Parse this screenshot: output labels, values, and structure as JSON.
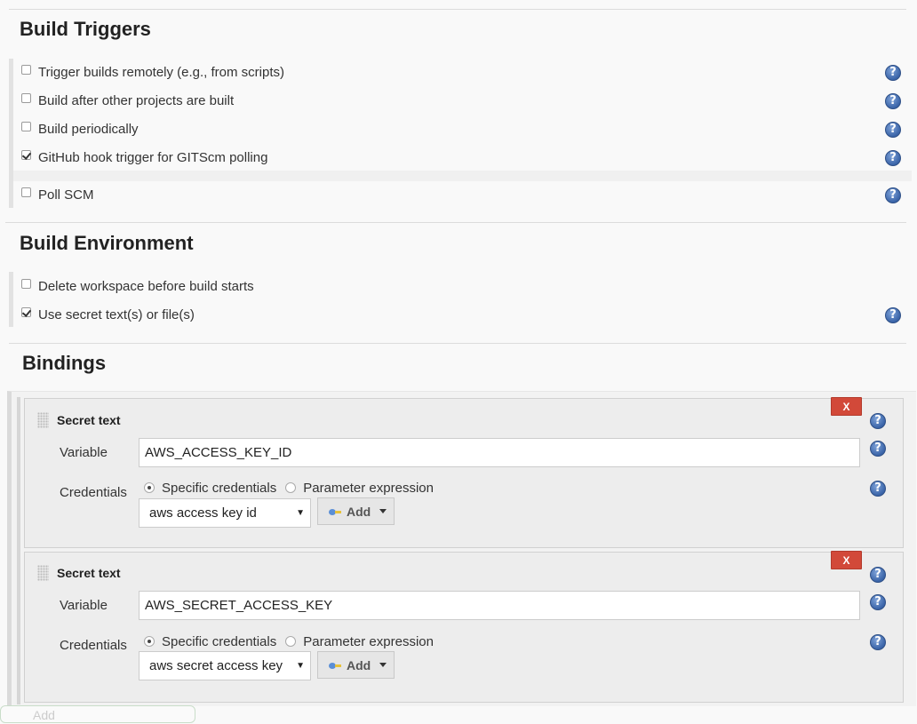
{
  "build_triggers": {
    "title": "Build Triggers",
    "options": [
      {
        "label": "Trigger builds remotely (e.g., from scripts)",
        "checked": false
      },
      {
        "label": "Build after other projects are built",
        "checked": false
      },
      {
        "label": "Build periodically",
        "checked": false
      },
      {
        "label": "GitHub hook trigger for GITScm polling",
        "checked": true
      },
      {
        "label": "Poll SCM",
        "checked": false
      }
    ]
  },
  "build_environment": {
    "title": "Build Environment",
    "options": [
      {
        "label": "Delete workspace before build starts",
        "checked": false
      },
      {
        "label": "Use secret text(s) or file(s)",
        "checked": true
      }
    ]
  },
  "bindings": {
    "title": "Bindings",
    "delete_label": "X",
    "help_glyph": "?",
    "items": [
      {
        "type_title": "Secret text",
        "variable_label": "Variable",
        "variable_value": "AWS_ACCESS_KEY_ID",
        "credentials_label": "Credentials",
        "radio_specific": "Specific credentials",
        "radio_param": "Parameter expression",
        "selected_credential": "aws access key id",
        "add_label": "Add"
      },
      {
        "type_title": "Secret text",
        "variable_label": "Variable",
        "variable_value": "AWS_SECRET_ACCESS_KEY",
        "credentials_label": "Credentials",
        "radio_specific": "Specific credentials",
        "radio_param": "Parameter expression",
        "selected_credential": "aws secret access key",
        "add_label": "Add"
      }
    ],
    "add_binding_label": "Add"
  },
  "colors": {
    "delete_button": "#d24939",
    "help_icon": "#3a64a8",
    "section_title": "#222222"
  },
  "icons": [
    "help-icon",
    "key-icon",
    "drag-handle-icon",
    "dropdown-caret-icon",
    "checkbox-checked",
    "radio-selected"
  ]
}
